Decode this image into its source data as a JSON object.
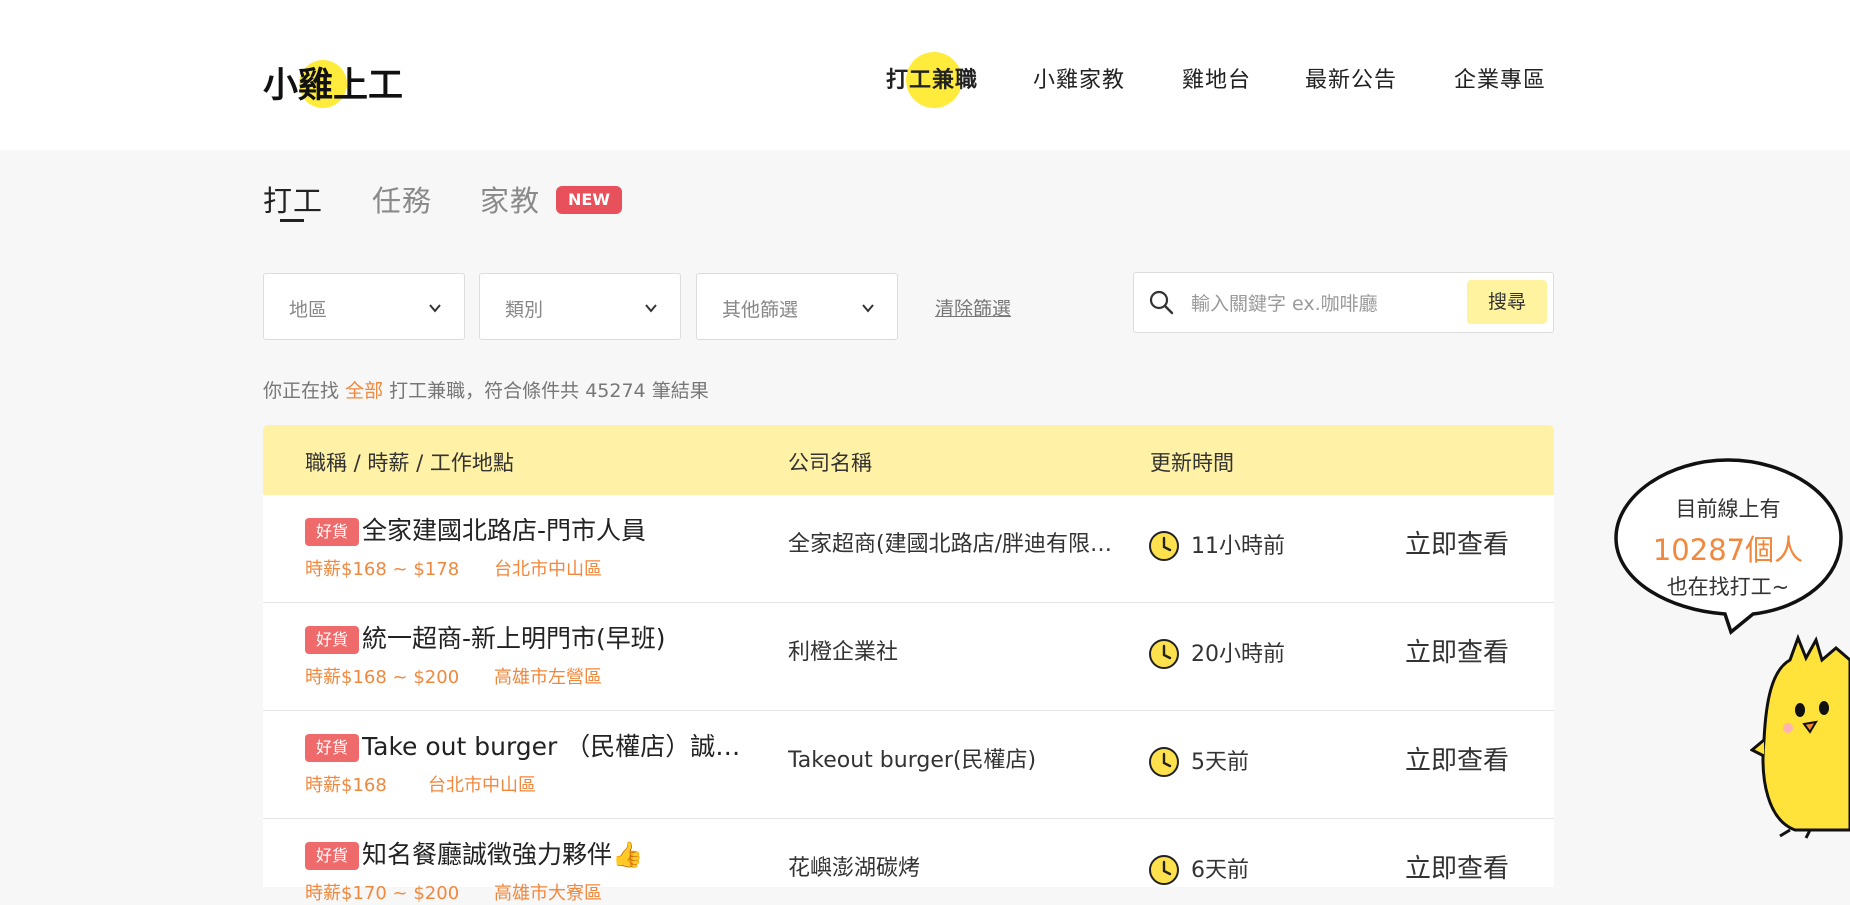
{
  "header": {
    "logo_text": "小雞上工",
    "nav": [
      {
        "label": "打工兼職",
        "active": true
      },
      {
        "label": "小雞家教",
        "active": false
      },
      {
        "label": "雞地台",
        "active": false
      },
      {
        "label": "最新公告",
        "active": false
      },
      {
        "label": "企業專區",
        "active": false
      }
    ]
  },
  "tabs": [
    {
      "label": "打工",
      "active": true
    },
    {
      "label": "任務",
      "active": false
    },
    {
      "label": "家教",
      "active": false,
      "badge": "NEW"
    }
  ],
  "filters": {
    "region": "地區",
    "category": "類別",
    "other": "其他篩選",
    "clear": "清除篩選"
  },
  "search": {
    "placeholder": "輸入關鍵字 ex.咖啡廳",
    "button": "搜尋"
  },
  "summary": {
    "prefix": "你正在找",
    "scope": "全部",
    "middle": "打工兼職，符合條件共",
    "count": "45274",
    "suffix": "筆結果"
  },
  "table": {
    "headers": [
      "職稱 / 時薪 / 工作地點",
      "公司名稱",
      "更新時間"
    ],
    "rows": [
      {
        "badge": "好貨",
        "title": "全家建國北路店-門市人員",
        "wage": "時薪$168 ~ $178",
        "location": "台北市中山區",
        "company": "全家超商(建國北路店/胖迪有限公司)",
        "updated": "11小時前",
        "action": "立即查看"
      },
      {
        "badge": "好貨",
        "title": "統一超商-新上明門市(早班)",
        "wage": "時薪$168 ~ $200",
        "location": "高雄市左營區",
        "company": "利橙企業社",
        "updated": "20小時前",
        "action": "立即查看"
      },
      {
        "badge": "好貨",
        "title": "Take out burger （民權店）誠徵夥伴",
        "wage": "時薪$168",
        "location": "台北市中山區",
        "company": "Takeout burger(民權店)",
        "updated": "5天前",
        "action": "立即查看"
      },
      {
        "badge": "好貨",
        "title": "知名餐廳誠徵強力夥伴👍",
        "wage": "時薪$170 ~ $200",
        "location": "高雄市大寮區",
        "company": "花嶼澎湖碳烤",
        "updated": "6天前",
        "action": "立即查看"
      }
    ]
  },
  "bubble": {
    "line1": "目前線上有",
    "line2": "10287個人",
    "line3": "也在找打工~"
  },
  "colors": {
    "accent_yellow": "#ffeb3b",
    "header_row_yellow": "#fff1a6",
    "orange": "#f0883e",
    "badge_red": "#ef6b6b",
    "new_badge_red": "#e8505b"
  }
}
